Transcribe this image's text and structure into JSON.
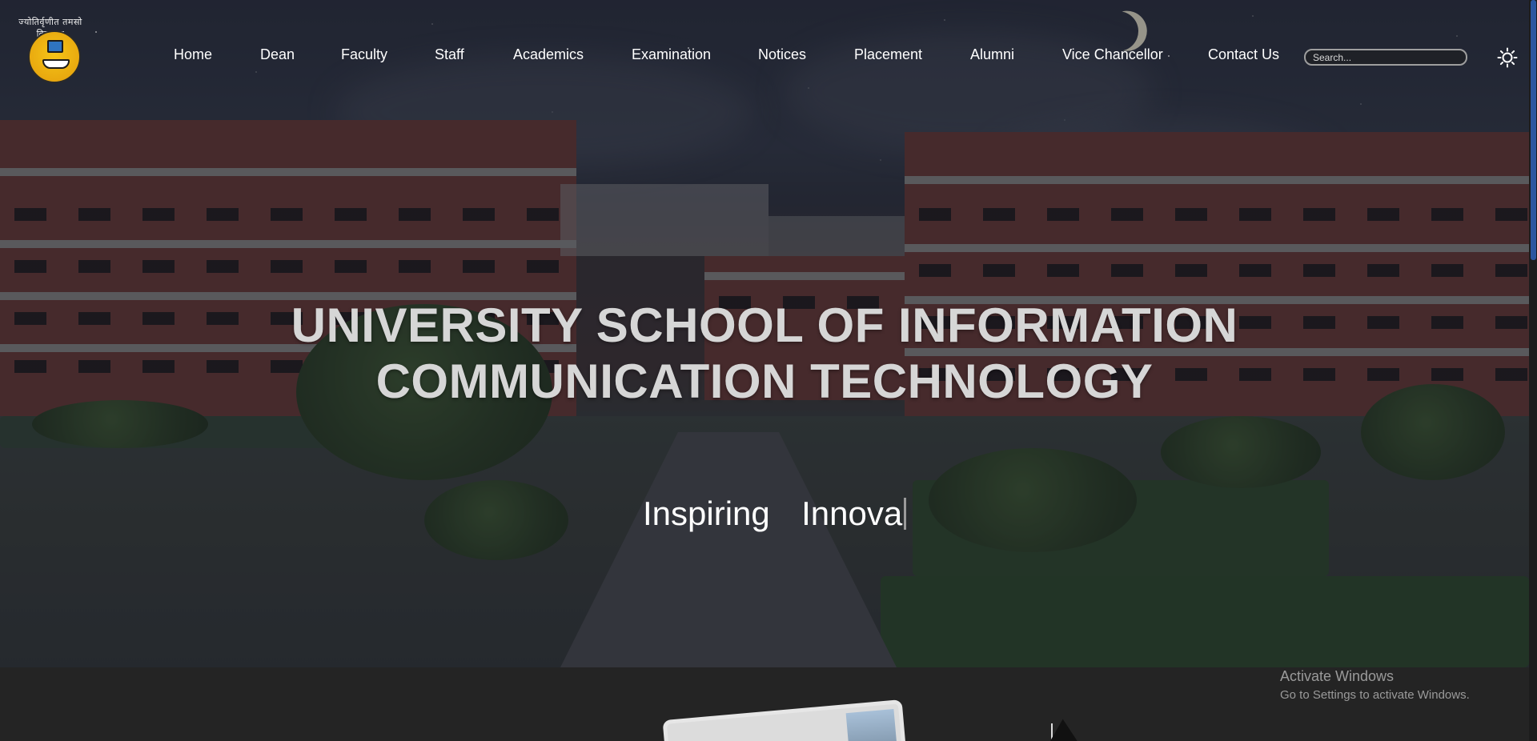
{
  "header": {
    "logo_text": "ज्योतिर्वृणीत तमसो विजानम्",
    "nav": [
      {
        "label": "Home"
      },
      {
        "label": "Dean"
      },
      {
        "label": "Faculty"
      },
      {
        "label": "Staff"
      },
      {
        "label": "Academics"
      },
      {
        "label": "Examination"
      },
      {
        "label": "Notices"
      },
      {
        "label": "Placement"
      },
      {
        "label": "Alumni"
      },
      {
        "label": "Vice Chancellor"
      },
      {
        "label": "Contact Us"
      }
    ],
    "search": {
      "placeholder": "Search...",
      "value": ""
    },
    "theme_toggle_icon": "sun-icon"
  },
  "hero": {
    "title_line1": "UNIVERSITY SCHOOL OF INFORMATION",
    "title_line2": "COMMUNICATION TECHNOLOGY",
    "tagline": "Inspiring  Innova"
  },
  "watermark": {
    "title": "Activate Windows",
    "subtitle": "Go to Settings to activate Windows."
  },
  "colors": {
    "nav_text": "#ffffff",
    "title_text": "#d6d6d6",
    "bottom_bg": "#242424",
    "scroll_thumb": "#2c57a0"
  }
}
